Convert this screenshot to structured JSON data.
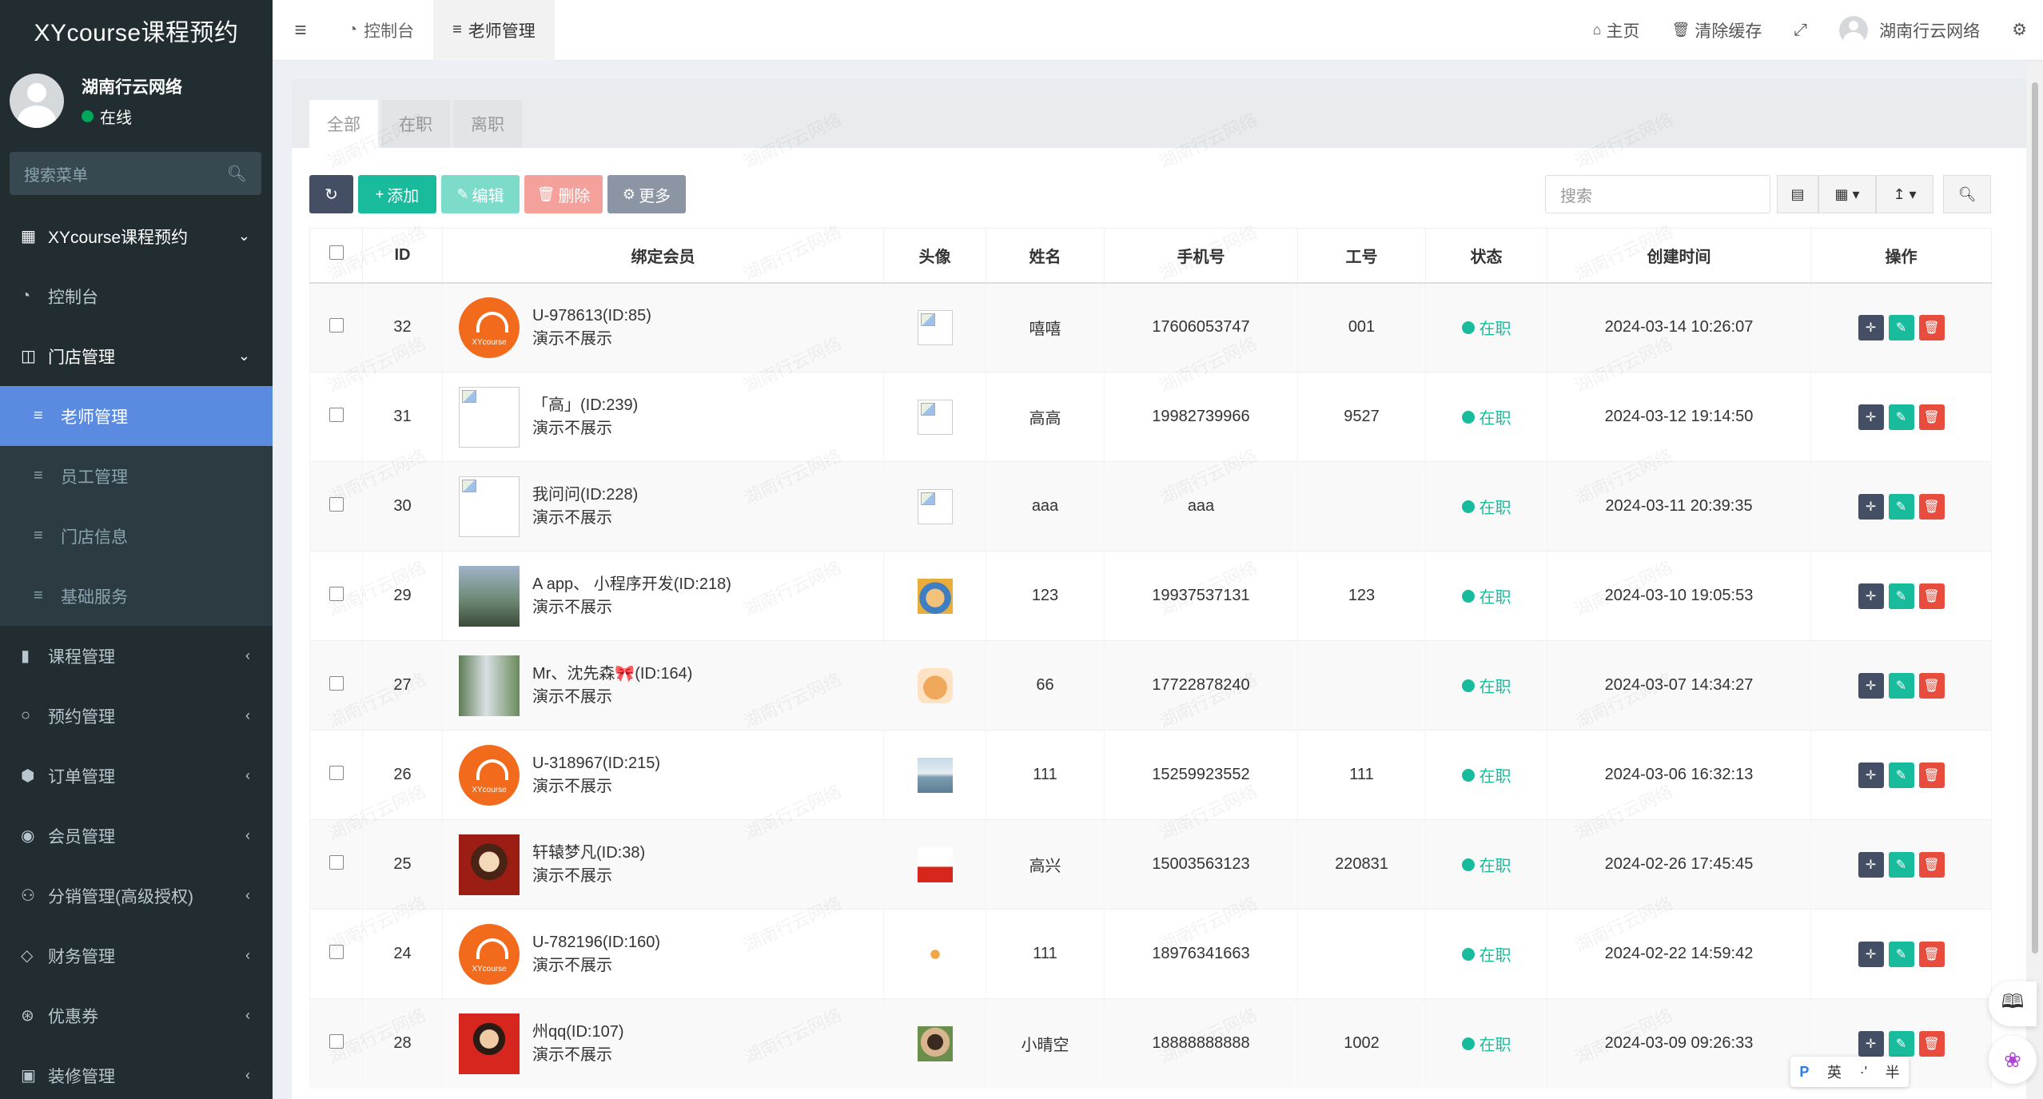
{
  "brand": {
    "title": "XYcourse课程预约"
  },
  "user": {
    "name": "湖南行云网络",
    "status": "在线"
  },
  "sidebar": {
    "search_placeholder": "搜索菜单",
    "items": [
      {
        "label": "XYcourse课程预约",
        "icon": "grid-icon"
      },
      {
        "label": "控制台",
        "icon": "dashboard-icon"
      },
      {
        "label": "门店管理",
        "icon": "store-icon"
      },
      {
        "label": "老师管理",
        "icon": "list-icon"
      },
      {
        "label": "员工管理",
        "icon": "list-icon"
      },
      {
        "label": "门店信息",
        "icon": "list-icon"
      },
      {
        "label": "基础服务",
        "icon": "list-icon"
      },
      {
        "label": "课程管理",
        "icon": "book-icon"
      },
      {
        "label": "预约管理",
        "icon": "whatsapp-icon"
      },
      {
        "label": "订单管理",
        "icon": "cube-icon"
      },
      {
        "label": "会员管理",
        "icon": "user-circle-icon"
      },
      {
        "label": "分销管理(高级授权)",
        "icon": "users-icon"
      },
      {
        "label": "财务管理",
        "icon": "diamond-icon"
      },
      {
        "label": "优惠券",
        "icon": "ticket-icon"
      },
      {
        "label": "装修管理",
        "icon": "image-icon"
      }
    ]
  },
  "navbar": {
    "tabs": [
      {
        "label": "控制台"
      },
      {
        "label": "老师管理"
      }
    ],
    "home": "主页",
    "clear_cache": "清除缓存",
    "user": "湖南行云网络"
  },
  "page": {
    "tabs": [
      "全部",
      "在职",
      "离职"
    ],
    "buttons": {
      "add": "添加",
      "edit": "编辑",
      "delete": "删除",
      "more": "更多"
    },
    "search_placeholder": "搜索",
    "watermark": "湖南行云网络"
  },
  "table": {
    "headers": [
      "ID",
      "绑定会员",
      "头像",
      "姓名",
      "手机号",
      "工号",
      "状态",
      "创建时间",
      "操作"
    ],
    "rows": [
      {
        "id": "32",
        "member": "U-978613(ID:85)",
        "note": "演示不展示",
        "name": "嘻嘻",
        "phone": "17606053747",
        "no": "001",
        "state": "在职",
        "created": "2024-03-14 10:26:07"
      },
      {
        "id": "31",
        "member": "「高」(ID:239)",
        "note": "演示不展示",
        "name": "高高",
        "phone": "19982739966",
        "no": "9527",
        "state": "在职",
        "created": "2024-03-12 19:14:50"
      },
      {
        "id": "30",
        "member": "我问问(ID:228)",
        "note": "演示不展示",
        "name": "aaa",
        "phone": "aaa",
        "no": "",
        "state": "在职",
        "created": "2024-03-11 20:39:35"
      },
      {
        "id": "29",
        "member": "A app、 小程序开发(ID:218)",
        "note": "演示不展示",
        "name": "123",
        "phone": "19937537131",
        "no": "123",
        "state": "在职",
        "created": "2024-03-10 19:05:53"
      },
      {
        "id": "27",
        "member": "Mr、沈先森🎀(ID:164)",
        "note": "演示不展示",
        "name": "66",
        "phone": "17722878240",
        "no": "",
        "state": "在职",
        "created": "2024-03-07 14:34:27"
      },
      {
        "id": "26",
        "member": "U-318967(ID:215)",
        "note": "演示不展示",
        "name": "111",
        "phone": "15259923552",
        "no": "111",
        "state": "在职",
        "created": "2024-03-06 16:32:13"
      },
      {
        "id": "25",
        "member": "轩辕梦凡(ID:38)",
        "note": "演示不展示",
        "name": "高兴",
        "phone": "15003563123",
        "no": "220831",
        "state": "在职",
        "created": "2024-02-26 17:45:45"
      },
      {
        "id": "24",
        "member": "U-782196(ID:160)",
        "note": "演示不展示",
        "name": "111",
        "phone": "18976341663",
        "no": "",
        "state": "在职",
        "created": "2024-02-22 14:59:42"
      },
      {
        "id": "28",
        "member": "州qq(ID:107)",
        "note": "演示不展示",
        "name": "小晴空",
        "phone": "18888888888",
        "no": "1002",
        "state": "在职",
        "created": "2024-03-09 09:26:33"
      }
    ]
  },
  "ime": {
    "lang": "英",
    "punct": "·'",
    "width": "半"
  },
  "colors": {
    "sidebar_bg": "#222d32",
    "active": "#5b8be0",
    "success": "#18bc9c",
    "danger": "#e74c3c"
  }
}
